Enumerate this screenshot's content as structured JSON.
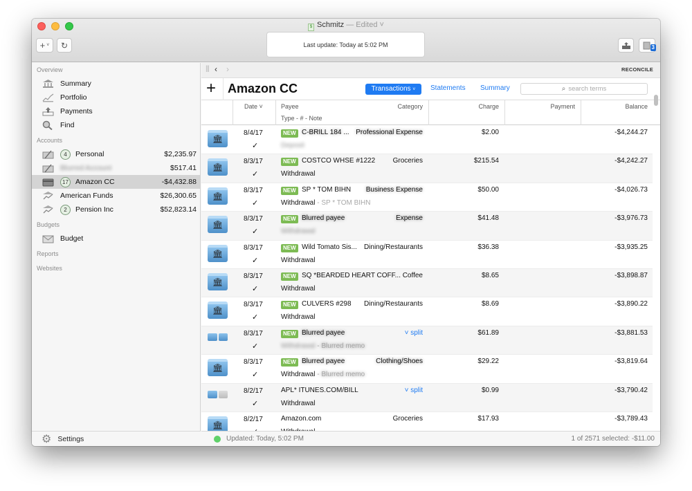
{
  "window": {
    "title": "Schmitz",
    "title_sep": " — ",
    "title_status": "Edited",
    "lcd_text": "Last update:  Today at 5:02 PM"
  },
  "toolbar": {
    "add_label": "+",
    "refresh_icon": "refresh-icon",
    "export_icon": "export-icon",
    "inbox_badge": "3"
  },
  "sidebar": {
    "sections": {
      "overview": "Overview",
      "accounts": "Accounts",
      "budgets": "Budgets",
      "reports": "Reports",
      "websites": "Websites"
    },
    "overview_items": [
      {
        "label": "Summary",
        "icon": "bank-icon"
      },
      {
        "label": "Portfolio",
        "icon": "chart-icon"
      },
      {
        "label": "Payments",
        "icon": "payments-icon"
      },
      {
        "label": "Find",
        "icon": "search-icon"
      }
    ],
    "accounts": [
      {
        "label": "Personal",
        "badge": "4",
        "amount": "$2,235.97",
        "blurred": false
      },
      {
        "label": "Blurred Account",
        "badge": "",
        "amount": "$517.41",
        "blurred": true
      },
      {
        "label": "Amazon CC",
        "badge": "17",
        "amount": "-$4,432.88",
        "selected": true
      },
      {
        "label": "American Funds",
        "badge": "",
        "amount": "$26,300.65"
      },
      {
        "label": "Pension Inc",
        "badge": "2",
        "amount": "$52,823.14"
      }
    ],
    "budget_item": "Budget",
    "settings_label": "Settings"
  },
  "main": {
    "nav": {
      "reconcile": "RECONCILE"
    },
    "account_title": "Amazon CC",
    "tabs": {
      "transactions": "Transactions",
      "statements": "Statements",
      "summary": "Summary"
    },
    "search_placeholder": "search terms",
    "columns": {
      "date": "Date",
      "payee": "Payee",
      "type_note": "Type  -  #  -  Note",
      "category": "Category",
      "charge": "Charge",
      "payment": "Payment",
      "balance": "Balance"
    },
    "new_label": "NEW",
    "split_label": "split",
    "transactions": [
      {
        "date": "8/4/17",
        "new": true,
        "payee": "C-BRILL 184 ...",
        "category": "Professional Expense",
        "type": "Deposit",
        "memo": "",
        "charge": "$2.00",
        "balance": "-$4,244.27",
        "blurred": true,
        "icon": "folder"
      },
      {
        "date": "8/3/17",
        "new": true,
        "payee": "COSTCO WHSE #1222",
        "category": "Groceries",
        "type": "Withdrawal",
        "memo": "",
        "charge": "$215.54",
        "balance": "-$4,242.27",
        "icon": "folder"
      },
      {
        "date": "8/3/17",
        "new": true,
        "payee": "SP * TOM BIHN",
        "category": "Business Expense",
        "category_blurred": true,
        "type": "Withdrawal",
        "memo": "SP * TOM BIHN",
        "charge": "$50.00",
        "balance": "-$4,026.73",
        "icon": "folder"
      },
      {
        "date": "8/3/17",
        "new": true,
        "payee": "Blurred payee",
        "category": "Expense",
        "type": "Withdrawal",
        "memo": "",
        "charge": "$41.48",
        "balance": "-$3,976.73",
        "blurred": true,
        "icon": "folder"
      },
      {
        "date": "8/3/17",
        "new": true,
        "payee": "Wild Tomato Sis...",
        "category": "Dining/Restaurants",
        "type": "Withdrawal",
        "memo": "",
        "charge": "$36.38",
        "balance": "-$3,935.25",
        "icon": "folder"
      },
      {
        "date": "8/3/17",
        "new": true,
        "payee": "SQ *BEARDED HEART COFF...",
        "category": "Coffee",
        "type": "Withdrawal",
        "memo": "",
        "charge": "$8.65",
        "balance": "-$3,898.87",
        "icon": "folder"
      },
      {
        "date": "8/3/17",
        "new": true,
        "payee": "CULVERS #298",
        "category": "Dining/Restaurants",
        "type": "Withdrawal",
        "memo": "",
        "charge": "$8.69",
        "balance": "-$3,890.22",
        "icon": "folder"
      },
      {
        "date": "8/3/17",
        "new": true,
        "payee": "Blurred payee",
        "split": true,
        "type": "Withdrawal",
        "memo": "Blurred memo",
        "charge": "$61.89",
        "balance": "-$3,881.53",
        "blurred": true,
        "icon": "split-blue"
      },
      {
        "date": "8/3/17",
        "new": true,
        "payee": "Blurred payee",
        "category": "Clothing/Shoes",
        "type": "Withdrawal",
        "memo": "Blurred memo",
        "charge": "$29.22",
        "balance": "-$3,819.64",
        "blurred_payee": true,
        "icon": "folder"
      },
      {
        "date": "8/2/17",
        "new": false,
        "payee": "APL* ITUNES.COM/BILL",
        "split": true,
        "type": "Withdrawal",
        "memo": "",
        "charge": "$0.99",
        "balance": "-$3,790.42",
        "icon": "split-mixed"
      },
      {
        "date": "8/2/17",
        "new": false,
        "payee": "Amazon.com",
        "category": "Groceries",
        "type": "Withdrawal",
        "memo": "",
        "charge": "$17.93",
        "balance": "-$3,789.43",
        "icon": "folder"
      }
    ],
    "status": {
      "updated": "Updated: Today, 5:02 PM",
      "selection": "1 of 2571 selected: -$11.00"
    }
  },
  "colors": {
    "accent": "#1f7bf2",
    "new_badge": "#7dbb54",
    "status_ok": "#5fd16a"
  }
}
